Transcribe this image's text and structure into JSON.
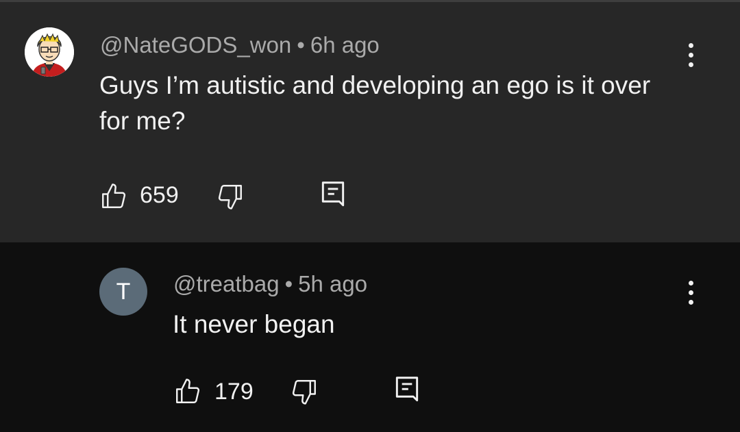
{
  "comments": [
    {
      "author": "@NateGODS_won",
      "separator": "•",
      "time": "6h ago",
      "text": "Guys I’m autistic and developing an ego is it over for me?",
      "likes": "659",
      "avatar": "cartoon-avatar"
    },
    {
      "author": "@treatbag",
      "separator": "•",
      "time": "5h ago",
      "text": "It never began",
      "likes": "179",
      "avatar_letter": "T",
      "avatar_color": "#5b6b78"
    }
  ],
  "icons": {
    "like": "thumbs-up-icon",
    "dislike": "thumbs-down-icon",
    "reply": "reply-icon",
    "more": "more-vertical-icon"
  }
}
